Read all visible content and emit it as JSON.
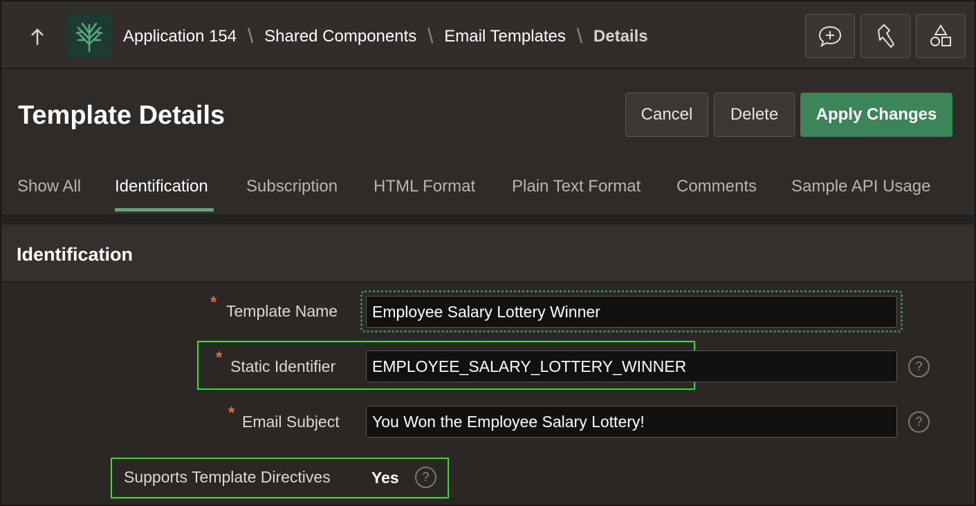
{
  "topbar": {
    "up_icon": "arrow-up-icon",
    "logo_icon": "tree-icon",
    "breadcrumb": [
      "Application 154",
      "Shared Components",
      "Email Templates",
      "Details"
    ],
    "tools": [
      "chat-add-icon",
      "flashlight-icon",
      "shapes-icon"
    ]
  },
  "header": {
    "title": "Template Details",
    "cancel_label": "Cancel",
    "delete_label": "Delete",
    "apply_label": "Apply Changes"
  },
  "tabs": [
    {
      "label": "Show All",
      "active": false
    },
    {
      "label": "Identification",
      "active": true
    },
    {
      "label": "Subscription",
      "active": false
    },
    {
      "label": "HTML Format",
      "active": false
    },
    {
      "label": "Plain Text Format",
      "active": false
    },
    {
      "label": "Comments",
      "active": false
    },
    {
      "label": "Sample API Usage",
      "active": false
    }
  ],
  "region": {
    "title": "Identification",
    "fields": {
      "template_name": {
        "label": "Template Name",
        "value": "Employee Salary Lottery Winner",
        "required": "*"
      },
      "static_identifier": {
        "label": "Static Identifier",
        "value": "EMPLOYEE_SALARY_LOTTERY_WINNER",
        "required": "*"
      },
      "email_subject": {
        "label": "Email Subject",
        "value": "You Won the Employee Salary Lottery!",
        "required": "*"
      },
      "directives": {
        "label": "Supports Template Directives",
        "value": "Yes"
      }
    },
    "help_glyph": "?"
  },
  "colors": {
    "accent": "#3c8559",
    "tab_underline": "#5aa877",
    "highlight": "#36e02f",
    "required": "#e06a4f"
  }
}
